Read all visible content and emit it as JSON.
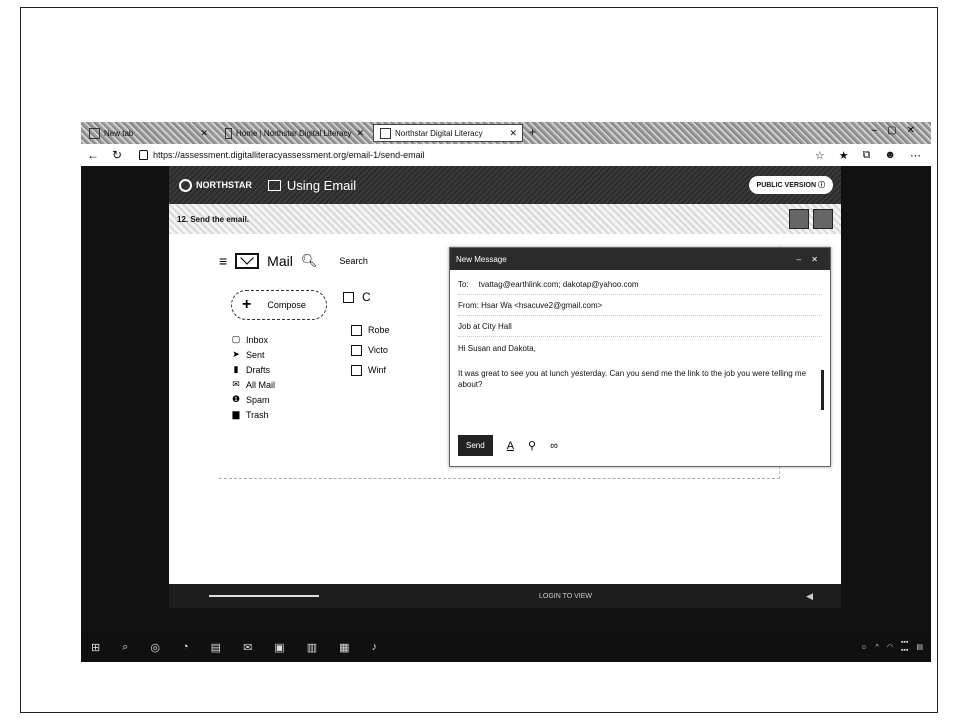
{
  "browser": {
    "tabs": [
      {
        "label": "New tab"
      },
      {
        "label": "Home | Northstar Digital Literacy"
      },
      {
        "label": "Northstar Digital Literacy"
      }
    ],
    "url": "https://assessment.digitalliteracyassessment.org/email-1/send-email"
  },
  "northstar": {
    "logo": "NORTHSTAR",
    "module": "Using Email",
    "public_version": "PUBLIC VERSION"
  },
  "task": {
    "prompt": "12. Send the email."
  },
  "mail": {
    "app_name": "Mail",
    "search_label": "Search",
    "compose_label": "Compose",
    "list_header_letter": "C",
    "folders": [
      {
        "label": "Inbox",
        "icon": "inbox-icon",
        "glyph": "▢"
      },
      {
        "label": "Sent",
        "icon": "sent-icon",
        "glyph": "➤"
      },
      {
        "label": "Drafts",
        "icon": "drafts-icon",
        "glyph": "▮"
      },
      {
        "label": "All Mail",
        "icon": "all-mail-icon",
        "glyph": "✉"
      },
      {
        "label": "Spam",
        "icon": "spam-icon",
        "glyph": "❶"
      },
      {
        "label": "Trash",
        "icon": "trash-icon",
        "glyph": "▆"
      }
    ],
    "rows": [
      {
        "sender": "Robe"
      },
      {
        "sender": "Victo"
      },
      {
        "sender": "Winf"
      }
    ]
  },
  "compose": {
    "title": "New Message",
    "to_label": "To:",
    "to_value": "tvattag@earthlink.com; dakotap@yahoo.com",
    "from": "From: Hsar Wa <hsacuve2@gmail.com>",
    "subject": "Job at City Hall",
    "greeting": "Hi Susan and Dakota,",
    "body": "It was great to see you at lunch yesterday. Can you send me the link to the job you were telling me about?",
    "send_label": "Send"
  },
  "video": {
    "title": "LOGIN TO VIEW"
  }
}
